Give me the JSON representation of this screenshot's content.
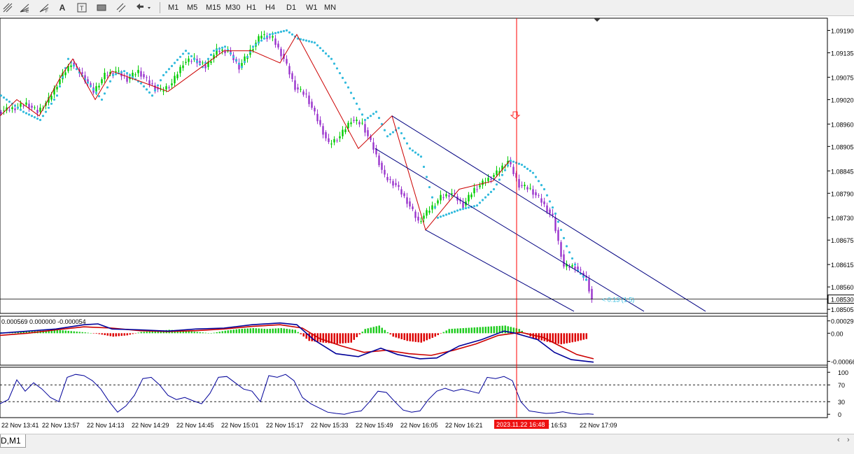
{
  "toolbar": {
    "timeframes": [
      "M1",
      "M5",
      "M15",
      "M30",
      "H1",
      "H4",
      "D1",
      "W1",
      "MN"
    ],
    "icons": [
      "fibonacci-tool-icon",
      "fibonacci-fan-icon",
      "text-icon",
      "text-label-icon",
      "rectangle-icon",
      "channel-tool-icon",
      "arrows-dropdown-icon"
    ]
  },
  "tab_label": "D,M1",
  "colors": {
    "bull": "#00cc00",
    "bear": "#9933cc",
    "sar": "#33bbdd",
    "zigzag": "#cc0000",
    "channel": "#000080",
    "macd_line": "#000099",
    "signal_line": "#cc0000",
    "hist_pos": "#22cc22",
    "hist_neg": "#dd0000",
    "stoch": "#000099",
    "cursor": "#ff0000"
  },
  "chart_data": [
    {
      "type": "candlestick",
      "y_ticks": [
        "1.09190",
        "1.09135",
        "1.09075",
        "1.09020",
        "1.08960",
        "1.08905",
        "1.08845",
        "1.08790",
        "1.08730",
        "1.08675",
        "1.08615",
        "1.08560",
        "1.08505"
      ],
      "ylim": [
        1.08495,
        1.0922
      ],
      "current_price": "1.08530",
      "annotation": "< 0:13 (1:5)",
      "price_path": [
        [
          0,
          1.0899
        ],
        [
          6,
          1.09
        ],
        [
          10,
          1.0901
        ],
        [
          14,
          1.0899
        ],
        [
          18,
          1.0902
        ],
        [
          22,
          1.0907
        ],
        [
          26,
          1.0911
        ],
        [
          30,
          1.0908
        ],
        [
          34,
          1.0904
        ],
        [
          38,
          1.0908
        ],
        [
          42,
          1.0909
        ],
        [
          46,
          1.0907
        ],
        [
          50,
          1.0909
        ],
        [
          54,
          1.0906
        ],
        [
          58,
          1.0904
        ],
        [
          62,
          1.0906
        ],
        [
          66,
          1.0911
        ],
        [
          70,
          1.0912
        ],
        [
          74,
          1.091
        ],
        [
          78,
          1.0914
        ],
        [
          82,
          1.0914
        ],
        [
          86,
          1.091
        ],
        [
          90,
          1.0914
        ],
        [
          94,
          1.0918
        ],
        [
          98,
          1.0917
        ],
        [
          102,
          1.0912
        ],
        [
          106,
          1.0905
        ],
        [
          110,
          1.0903
        ],
        [
          114,
          1.0897
        ],
        [
          118,
          1.0891
        ],
        [
          122,
          1.0893
        ],
        [
          126,
          1.0897
        ],
        [
          130,
          1.0896
        ],
        [
          134,
          1.089
        ],
        [
          138,
          1.0883
        ],
        [
          142,
          1.0881
        ],
        [
          146,
          1.0877
        ],
        [
          150,
          1.0872
        ],
        [
          154,
          1.0875
        ],
        [
          158,
          1.0878
        ],
        [
          162,
          1.0879
        ],
        [
          166,
          1.0876
        ],
        [
          170,
          1.088
        ],
        [
          174,
          1.0882
        ],
        [
          178,
          1.0884
        ],
        [
          182,
          1.0887
        ],
        [
          186,
          1.0881
        ],
        [
          190,
          1.088
        ],
        [
          194,
          1.0877
        ],
        [
          198,
          1.0873
        ],
        [
          202,
          1.0861
        ],
        [
          206,
          1.0861
        ],
        [
          210,
          1.0858
        ],
        [
          212,
          1.0853
        ]
      ],
      "sar_points": [
        [
          0,
          1.0903
        ],
        [
          8,
          1.0899
        ],
        [
          14,
          1.0897
        ],
        [
          20,
          1.0903
        ],
        [
          24,
          1.0912
        ],
        [
          30,
          1.0907
        ],
        [
          36,
          1.0902
        ],
        [
          40,
          1.0908
        ],
        [
          44,
          1.0909
        ],
        [
          50,
          1.0906
        ],
        [
          54,
          1.0903
        ],
        [
          58,
          1.0908
        ],
        [
          62,
          1.0911
        ],
        [
          66,
          1.0914
        ],
        [
          72,
          1.091
        ],
        [
          76,
          1.0914
        ],
        [
          80,
          1.0915
        ],
        [
          86,
          1.091
        ],
        [
          90,
          1.0915
        ],
        [
          96,
          1.0918
        ],
        [
          102,
          1.0919
        ],
        [
          106,
          1.0917
        ],
        [
          112,
          1.0916
        ],
        [
          118,
          1.0912
        ],
        [
          124,
          1.0905
        ],
        [
          130,
          1.0897
        ],
        [
          134,
          1.0899
        ],
        [
          138,
          1.0893
        ],
        [
          142,
          1.0895
        ],
        [
          146,
          1.089
        ],
        [
          150,
          1.0888
        ],
        [
          156,
          1.0873
        ],
        [
          160,
          1.0874
        ],
        [
          164,
          1.0875
        ],
        [
          170,
          1.0876
        ],
        [
          176,
          1.088
        ],
        [
          182,
          1.0887
        ],
        [
          186,
          1.0886
        ],
        [
          190,
          1.0884
        ],
        [
          194,
          1.088
        ],
        [
          198,
          1.0874
        ],
        [
          202,
          1.0866
        ],
        [
          206,
          1.086
        ],
        [
          210,
          1.0857
        ]
      ],
      "zigzag": [
        [
          0,
          1.0898
        ],
        [
          6,
          1.0902
        ],
        [
          14,
          1.0898
        ],
        [
          22,
          1.0908
        ],
        [
          26,
          1.0912
        ],
        [
          34,
          1.0902
        ],
        [
          40,
          1.0909
        ],
        [
          52,
          1.0906
        ],
        [
          60,
          1.0904
        ],
        [
          72,
          1.091
        ],
        [
          80,
          1.0914
        ],
        [
          90,
          1.0914
        ],
        [
          100,
          1.0911
        ],
        [
          106,
          1.0918
        ],
        [
          128,
          1.089
        ],
        [
          140,
          1.0898
        ],
        [
          152,
          1.087
        ],
        [
          164,
          1.088
        ],
        [
          176,
          1.0882
        ],
        [
          182,
          1.0887
        ]
      ],
      "channel_upper": [
        [
          140,
          1.0898
        ],
        [
          252,
          1.085
        ]
      ],
      "channel_middle": [
        [
          134,
          1.089
        ],
        [
          230,
          1.085
        ]
      ],
      "channel_lower": [
        [
          152,
          1.087
        ],
        [
          205,
          1.085
        ]
      ],
      "cursor_x": 184.5
    },
    {
      "type": "macd",
      "header": "0.000569 0.000000 -0.000054",
      "y_ticks": [
        "0.00029",
        "0.00",
        "-0.00066"
      ],
      "ylim": [
        -0.00075,
        0.0004
      ],
      "histogram": [
        [
          0,
          2e-05
        ],
        [
          5,
          2e-05
        ],
        [
          10,
          4e-05
        ],
        [
          15,
          6e-05
        ],
        [
          20,
          8e-05
        ],
        [
          25,
          5e-05
        ],
        [
          30,
          2e-05
        ],
        [
          35,
          -2e-05
        ],
        [
          40,
          -8e-05
        ],
        [
          45,
          -5e-05
        ],
        [
          50,
          3e-05
        ],
        [
          55,
          5e-05
        ],
        [
          60,
          8e-05
        ],
        [
          65,
          6e-05
        ],
        [
          70,
          3e-05
        ],
        [
          75,
          0.0
        ],
        [
          80,
          6e-05
        ],
        [
          85,
          0.0001
        ],
        [
          90,
          0.00012
        ],
        [
          95,
          0.0001
        ],
        [
          100,
          0.00012
        ],
        [
          105,
          8e-05
        ],
        [
          110,
          -0.00018
        ],
        [
          115,
          -0.00022
        ],
        [
          120,
          -0.00025
        ],
        [
          125,
          -0.00022
        ],
        [
          130,
          0.0001
        ],
        [
          135,
          0.00018
        ],
        [
          140,
          -8e-05
        ],
        [
          145,
          -0.00018
        ],
        [
          150,
          -0.00022
        ],
        [
          155,
          -8e-05
        ],
        [
          160,
          0.0001
        ],
        [
          165,
          0.00012
        ],
        [
          170,
          0.00014
        ],
        [
          175,
          0.00016
        ],
        [
          180,
          0.00018
        ],
        [
          185,
          0.0001
        ],
        [
          190,
          -0.00012
        ],
        [
          195,
          -0.0002
        ],
        [
          200,
          -0.00026
        ],
        [
          205,
          -0.0002
        ],
        [
          210,
          -0.00012
        ]
      ],
      "macd_line": [
        [
          0,
          0.0
        ],
        [
          10,
          5e-05
        ],
        [
          20,
          0.0001
        ],
        [
          30,
          0.0002
        ],
        [
          35,
          0.00022
        ],
        [
          40,
          0.0001
        ],
        [
          50,
          8e-05
        ],
        [
          60,
          5e-05
        ],
        [
          70,
          0.0001
        ],
        [
          80,
          0.00012
        ],
        [
          90,
          0.0002
        ],
        [
          100,
          0.00024
        ],
        [
          106,
          0.0002
        ],
        [
          112,
          -0.00015
        ],
        [
          120,
          -0.00048
        ],
        [
          128,
          -0.00055
        ],
        [
          136,
          -0.00035
        ],
        [
          142,
          -0.0005
        ],
        [
          150,
          -0.0006
        ],
        [
          156,
          -0.00058
        ],
        [
          164,
          -0.0003
        ],
        [
          172,
          -0.00015
        ],
        [
          180,
          5e-05
        ],
        [
          184,
          0.0
        ],
        [
          192,
          -0.00015
        ],
        [
          198,
          -0.00045
        ],
        [
          204,
          -0.00062
        ],
        [
          212,
          -0.00068
        ]
      ],
      "signal_line": [
        [
          0,
          -5e-05
        ],
        [
          10,
          0.0
        ],
        [
          20,
          8e-05
        ],
        [
          30,
          0.00015
        ],
        [
          40,
          0.00012
        ],
        [
          50,
          6e-05
        ],
        [
          60,
          4e-05
        ],
        [
          70,
          6e-05
        ],
        [
          80,
          0.0001
        ],
        [
          90,
          0.00016
        ],
        [
          100,
          0.0002
        ],
        [
          108,
          0.00012
        ],
        [
          114,
          -0.00012
        ],
        [
          122,
          -0.0003
        ],
        [
          130,
          -0.00045
        ],
        [
          138,
          -0.0004
        ],
        [
          146,
          -0.00048
        ],
        [
          154,
          -0.00052
        ],
        [
          162,
          -0.0004
        ],
        [
          170,
          -0.00025
        ],
        [
          178,
          -5e-05
        ],
        [
          186,
          2e-05
        ],
        [
          194,
          -0.0001
        ],
        [
          200,
          -0.0003
        ],
        [
          206,
          -0.0005
        ],
        [
          212,
          -0.0006
        ]
      ]
    },
    {
      "type": "stochastic",
      "y_ticks": [
        "100",
        "70",
        "30",
        "0"
      ],
      "ylim": [
        -8,
        112
      ],
      "levels": [
        70,
        30
      ],
      "values": [
        [
          0,
          25
        ],
        [
          3,
          35
        ],
        [
          6,
          82
        ],
        [
          9,
          55
        ],
        [
          12,
          75
        ],
        [
          15,
          60
        ],
        [
          18,
          40
        ],
        [
          21,
          30
        ],
        [
          24,
          88
        ],
        [
          27,
          95
        ],
        [
          30,
          92
        ],
        [
          33,
          80
        ],
        [
          36,
          60
        ],
        [
          39,
          30
        ],
        [
          42,
          5
        ],
        [
          45,
          20
        ],
        [
          48,
          45
        ],
        [
          51,
          85
        ],
        [
          54,
          88
        ],
        [
          57,
          70
        ],
        [
          60,
          45
        ],
        [
          63,
          35
        ],
        [
          66,
          40
        ],
        [
          69,
          32
        ],
        [
          72,
          25
        ],
        [
          75,
          50
        ],
        [
          78,
          88
        ],
        [
          81,
          90
        ],
        [
          84,
          75
        ],
        [
          87,
          60
        ],
        [
          90,
          55
        ],
        [
          93,
          30
        ],
        [
          96,
          92
        ],
        [
          99,
          88
        ],
        [
          102,
          95
        ],
        [
          105,
          80
        ],
        [
          108,
          40
        ],
        [
          111,
          25
        ],
        [
          114,
          15
        ],
        [
          117,
          5
        ],
        [
          120,
          2
        ],
        [
          123,
          0
        ],
        [
          126,
          5
        ],
        [
          129,
          8
        ],
        [
          132,
          30
        ],
        [
          135,
          55
        ],
        [
          138,
          52
        ],
        [
          141,
          30
        ],
        [
          144,
          10
        ],
        [
          147,
          5
        ],
        [
          150,
          8
        ],
        [
          153,
          35
        ],
        [
          156,
          55
        ],
        [
          159,
          62
        ],
        [
          162,
          55
        ],
        [
          165,
          60
        ],
        [
          168,
          55
        ],
        [
          171,
          50
        ],
        [
          174,
          88
        ],
        [
          177,
          85
        ],
        [
          180,
          90
        ],
        [
          183,
          80
        ],
        [
          186,
          30
        ],
        [
          189,
          8
        ],
        [
          192,
          5
        ],
        [
          195,
          2
        ],
        [
          198,
          3
        ],
        [
          201,
          6
        ],
        [
          204,
          2
        ],
        [
          207,
          0
        ],
        [
          210,
          1
        ],
        [
          212,
          0
        ]
      ]
    }
  ],
  "time_axis": {
    "labels": [
      "22 Nov 13:41",
      "22 Nov 13:57",
      "22 Nov 14:13",
      "22 Nov 14:29",
      "22 Nov 14:45",
      "22 Nov 15:01",
      "22 Nov 15:17",
      "22 Nov 15:33",
      "22 Nov 15:49",
      "22 Nov 16:05",
      "22 Nov 16:21",
      "ov 16:53",
      "22 Nov 17:09"
    ],
    "cursor_label": "2023.11.22 16:48"
  }
}
